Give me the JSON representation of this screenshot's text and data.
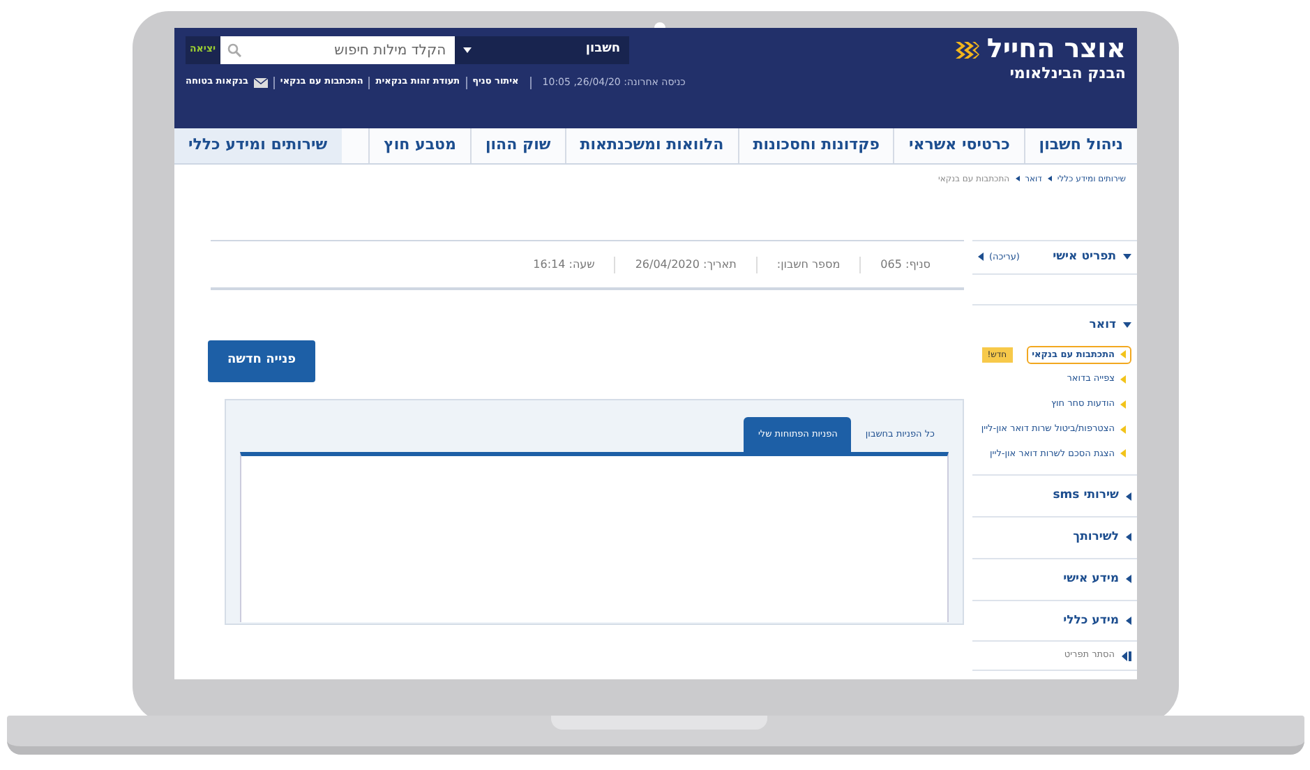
{
  "header": {
    "logo": {
      "name": "אוצר החייל",
      "subtitle": "הבנק הבינלאומי"
    },
    "account_select": "חשבון",
    "search": {
      "placeholder": "הקלד מילות חיפוש"
    },
    "logout": "יציאה",
    "last_login": "כניסה אחרונה: 26/04/20, 10:05",
    "links": [
      {
        "label": "איתור סניף",
        "kind": "text"
      },
      {
        "label": "תעודת זהות בנקאית",
        "kind": "text"
      },
      {
        "label": "התכתבות עם בנקאי",
        "kind": "text"
      },
      {
        "label": "בנקאות בטוחה",
        "kind": "mail"
      }
    ]
  },
  "nav_tabs": [
    {
      "label": "ניהול חשבון",
      "selected": false
    },
    {
      "label": "כרטיסי אשראי",
      "selected": false
    },
    {
      "label": "פקדונות וחסכונות",
      "selected": false
    },
    {
      "label": "הלוואות ומשכנתאות",
      "selected": false
    },
    {
      "label": "שוק ההון",
      "selected": false
    },
    {
      "label": "מטבע חוץ",
      "selected": false
    },
    {
      "label": "שירותים ומידע כללי",
      "selected": true
    }
  ],
  "breadcrumb": [
    "שירותים ומידע כללי",
    "דואר",
    "התכתבות עם בנקאי"
  ],
  "info_bar": [
    "סניף: 065",
    "מספר חשבון:",
    "תאריך: 26/04/2020",
    "שעה: 16:14"
  ],
  "sidebar": {
    "personal_menu": {
      "label": "תפריט אישי",
      "edit": "(עריכה)",
      "expanded": true
    },
    "sections": [
      {
        "label": "דואר",
        "expanded": true,
        "items": [
          {
            "label": "התכתבות עם בנקאי",
            "selected": true,
            "badge": "חדש!"
          },
          {
            "label": "צפייה בדואר",
            "selected": false
          },
          {
            "label": "הודעות סחר חוץ",
            "selected": false
          },
          {
            "label": "הצטרפות/ביטול שרות דואר און-ליין",
            "selected": false
          },
          {
            "label": "הצגת הסכם לשרות דואר און-ליין",
            "selected": false
          }
        ]
      },
      {
        "label": "שירותי sms",
        "expanded": false
      },
      {
        "label": "לשירותך",
        "expanded": false
      },
      {
        "label": "מידע אישי",
        "expanded": false
      },
      {
        "label": "מידע כללי",
        "expanded": false
      }
    ],
    "hide_menu": "הסתר תפריט"
  },
  "new_request_button": "פנייה חדשה",
  "panel_tabs": [
    {
      "label": "כל הפניות בחשבון",
      "selected": false
    },
    {
      "label": "הפניות הפתוחות שלי",
      "selected": true
    }
  ]
}
